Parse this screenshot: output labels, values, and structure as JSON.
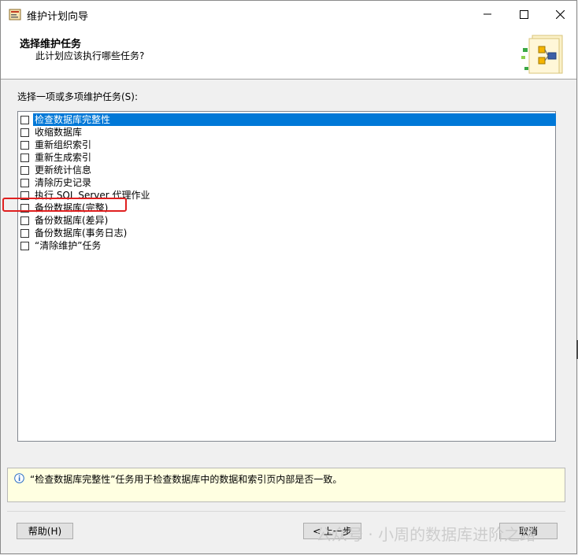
{
  "window": {
    "title": "维护计划向导",
    "minimize_icon": "minimize-icon",
    "maximize_icon": "maximize-icon",
    "close_icon": "close-icon"
  },
  "header": {
    "title": "选择维护任务",
    "subtitle": "此计划应该执行哪些任务?"
  },
  "section_label": "选择一项或多项维护任务(S):",
  "tasks": [
    {
      "label": "检查数据库完整性",
      "checked": false,
      "selected": true
    },
    {
      "label": "收缩数据库",
      "checked": false,
      "selected": false
    },
    {
      "label": "重新组织索引",
      "checked": false,
      "selected": false
    },
    {
      "label": "重新生成索引",
      "checked": false,
      "selected": false
    },
    {
      "label": "更新统计信息",
      "checked": false,
      "selected": false
    },
    {
      "label": "清除历史记录",
      "checked": false,
      "selected": false
    },
    {
      "label": "执行 SQL Server 代理作业",
      "checked": false,
      "selected": false
    },
    {
      "label": "备份数据库(完整)",
      "checked": false,
      "selected": false
    },
    {
      "label": "备份数据库(差异)",
      "checked": false,
      "selected": false
    },
    {
      "label": "备份数据库(事务日志)",
      "checked": false,
      "selected": false
    },
    {
      "label": "“清除维护”任务",
      "checked": false,
      "selected": false
    }
  ],
  "info": {
    "icon": "info-icon",
    "text": "“检查数据库完整性”任务用于检查数据库中的数据和索引页内部是否一致。"
  },
  "buttons": {
    "help": "帮助(H)",
    "back": "< 上一步",
    "cancel": "取消"
  },
  "watermark": "公众号 · 小周的数据库进阶之路",
  "colors": {
    "selection": "#0078d7",
    "info_background": "#ffffe1",
    "highlight_box": "#e02020"
  }
}
